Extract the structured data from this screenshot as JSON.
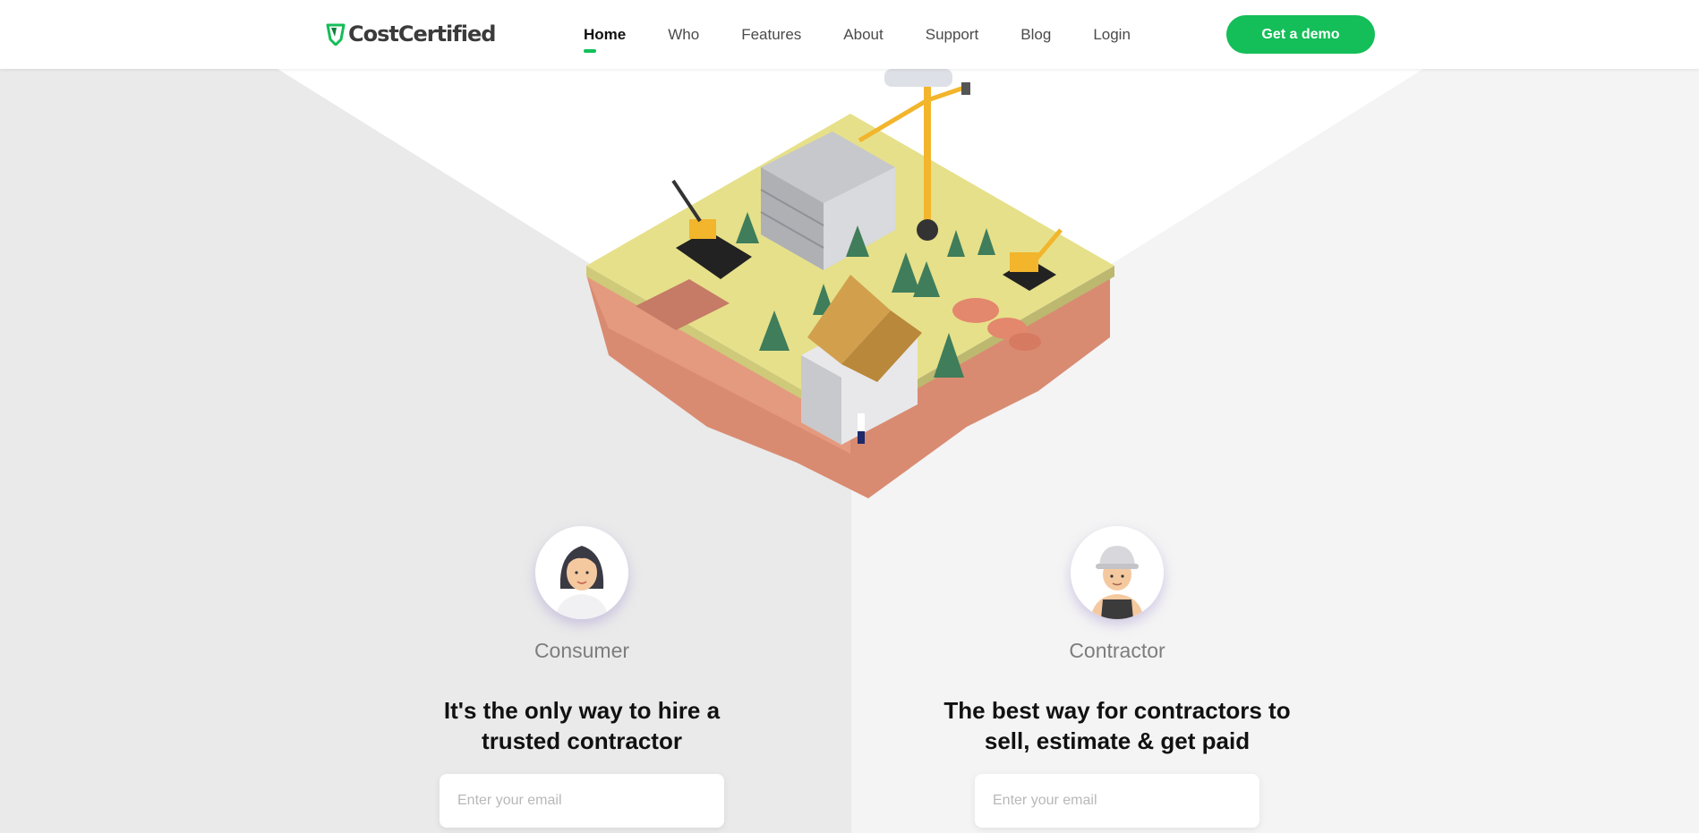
{
  "header": {
    "logo_text": "CostCertified",
    "nav": [
      {
        "label": "Home",
        "active": true
      },
      {
        "label": "Who",
        "active": false
      },
      {
        "label": "Features",
        "active": false
      },
      {
        "label": "About",
        "active": false
      },
      {
        "label": "Support",
        "active": false
      },
      {
        "label": "Blog",
        "active": false
      },
      {
        "label": "Login",
        "active": false
      }
    ],
    "cta_label": "Get a demo"
  },
  "colors": {
    "accent": "#14be58",
    "left_bg": "#eaeaea",
    "right_bg": "#f4f4f4"
  },
  "consumer": {
    "role": "Consumer",
    "headline_line1": "It's the only way to hire a",
    "headline_line2": "trusted contractor",
    "email_placeholder": "Enter your email"
  },
  "contractor": {
    "role": "Contractor",
    "headline_line1": "The best way for contractors to",
    "headline_line2": "sell, estimate & get paid",
    "email_placeholder": "Enter your email"
  }
}
